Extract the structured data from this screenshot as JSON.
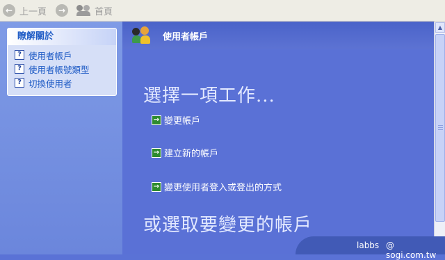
{
  "toolbar": {
    "back_label": "上一頁",
    "back_icon": "back-arrow-icon",
    "forward_icon": "forward-arrow-icon",
    "home_label": "首頁",
    "home_icon": "users-icon"
  },
  "sidebar": {
    "title": "瞭解關於",
    "links": [
      {
        "label": "使用者帳戶",
        "icon": "help-icon"
      },
      {
        "label": "使用者帳號類型",
        "icon": "help-icon"
      },
      {
        "label": "切換使用者",
        "icon": "help-icon"
      }
    ]
  },
  "header": {
    "title": "使用者帳戶",
    "icon": "user-accounts-icon"
  },
  "main": {
    "pick_task_heading": "選擇一項工作...",
    "tasks": [
      {
        "label": "變更帳戶",
        "icon": "green-arrow-icon"
      },
      {
        "label": "建立新的帳戶",
        "icon": "green-arrow-icon"
      },
      {
        "label": "變更使用者登入或登出的方式",
        "icon": "green-arrow-icon"
      }
    ],
    "pick_account_heading": "或選取要變更的帳戶"
  },
  "watermark": {
    "brand": "labbs",
    "site": "@ sogi.com.tw"
  },
  "colors": {
    "background": "#5a72d6",
    "header": "#4a63c9",
    "link": "#215dc6",
    "task_arrow": "#2e8b2e"
  }
}
